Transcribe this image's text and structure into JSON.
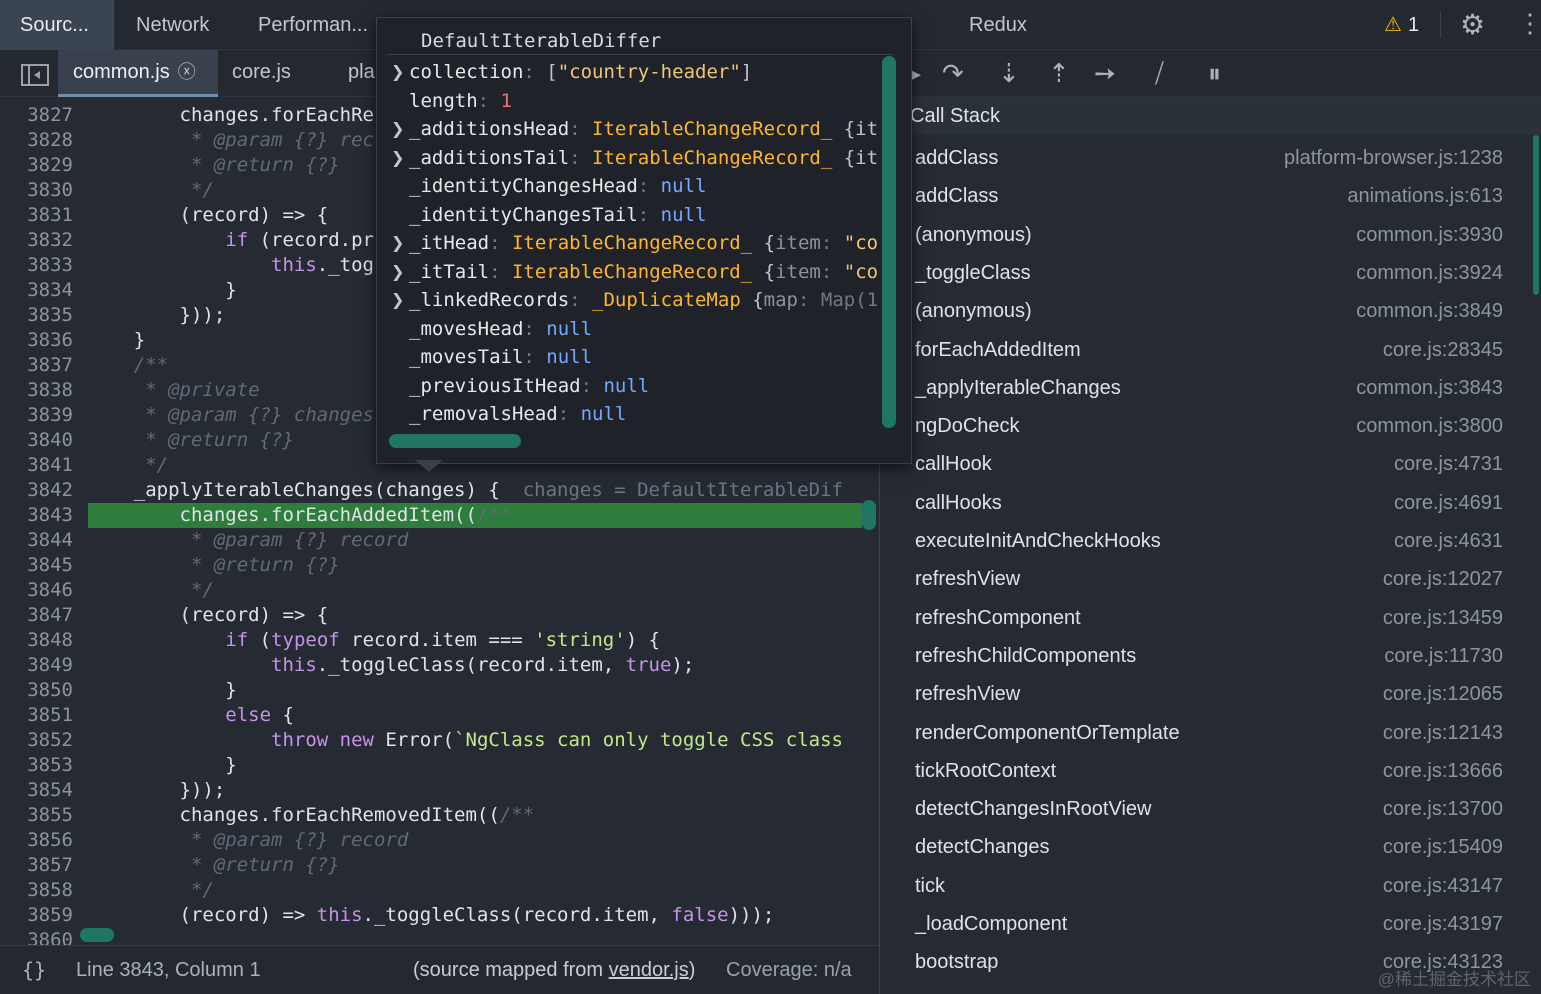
{
  "panel_tabs": {
    "sources": "Sourc...",
    "network": "Network",
    "performance": "Performan...",
    "redux": "Redux",
    "warning_count": "1"
  },
  "file_tabs": [
    "common.js",
    "core.js",
    "pla"
  ],
  "code_lines": [
    {
      "n": "3827",
      "html": "        changes.forEachRe"
    },
    {
      "n": "3828",
      "html": "         <span class=\"cm\">* @param {?} rec</span>"
    },
    {
      "n": "3829",
      "html": "         <span class=\"cm\">* @return {?}</span>"
    },
    {
      "n": "3830",
      "html": "         <span class=\"cm\">*/</span>"
    },
    {
      "n": "3831",
      "html": "        (record) =&gt; {"
    },
    {
      "n": "3832",
      "html": "            <span class=\"kw\">if</span> (record.pr"
    },
    {
      "n": "3833",
      "html": "                <span class=\"kw\">this</span>._tog"
    },
    {
      "n": "3834",
      "html": "            }"
    },
    {
      "n": "3835",
      "html": "        }));"
    },
    {
      "n": "3836",
      "html": "    }"
    },
    {
      "n": "3837",
      "html": "    <span class=\"cm\">/**</span>"
    },
    {
      "n": "3838",
      "html": "     <span class=\"cm\">* @private</span>"
    },
    {
      "n": "3839",
      "html": "     <span class=\"cm\">* @param {?} changes</span>"
    },
    {
      "n": "3840",
      "html": "     <span class=\"cm\">* @return {?}</span>"
    },
    {
      "n": "3841",
      "html": "     <span class=\"cm\">*/</span>"
    },
    {
      "n": "3842",
      "html": "    _applyIterableChanges(changes) {  <span class=\"inl\">changes = DefaultIterableDif</span>"
    },
    {
      "n": "3843",
      "html": "        changes.forEachAddedItem((<span class=\"cm\">/**</span>"
    },
    {
      "n": "3844",
      "html": "         <span class=\"cm\">* @param {?} record</span>"
    },
    {
      "n": "3845",
      "html": "         <span class=\"cm\">* @return {?}</span>"
    },
    {
      "n": "3846",
      "html": "         <span class=\"cm\">*/</span>"
    },
    {
      "n": "3847",
      "html": "        (record) =&gt; {"
    },
    {
      "n": "3848",
      "html": "            <span class=\"kw\">if</span> (<span class=\"kw\">typeof</span> record.item === <span class=\"str\">'string'</span>) {"
    },
    {
      "n": "3849",
      "html": "                <span class=\"kw\">this</span>._toggleClass(record.item, <span class=\"kw\">true</span>);"
    },
    {
      "n": "3850",
      "html": "            }"
    },
    {
      "n": "3851",
      "html": "            <span class=\"kw\">else</span> {"
    },
    {
      "n": "3852",
      "html": "                <span class=\"kw\">throw new</span> Error(<span class=\"str\">`NgClass can only toggle CSS class</span>"
    },
    {
      "n": "3853",
      "html": "            }"
    },
    {
      "n": "3854",
      "html": "        }));"
    },
    {
      "n": "3855",
      "html": "        changes.forEachRemovedItem((<span class=\"cm\">/**</span>"
    },
    {
      "n": "3856",
      "html": "         <span class=\"cm\">* @param {?} record</span>"
    },
    {
      "n": "3857",
      "html": "         <span class=\"cm\">* @return {?}</span>"
    },
    {
      "n": "3858",
      "html": "         <span class=\"cm\">*/</span>"
    },
    {
      "n": "3859",
      "html": "        (record) =&gt; <span class=\"kw\">this</span>._toggleClass(record.item, <span class=\"kw\">false</span>)));"
    },
    {
      "n": "3860",
      "html": ""
    }
  ],
  "highlighted_line": "3843",
  "status": {
    "braces": "{}",
    "position": "Line 3843, Column 1",
    "source_map_prefix": "(source mapped from ",
    "source_map_file": "vendor.js",
    "source_map_suffix": ")",
    "coverage": "Coverage: n/a"
  },
  "call_stack": {
    "title": "Call Stack",
    "frames": [
      {
        "fn": "addClass",
        "loc": "platform-browser.js:1238"
      },
      {
        "fn": "addClass",
        "loc": "animations.js:613"
      },
      {
        "fn": "(anonymous)",
        "loc": "common.js:3930"
      },
      {
        "fn": "_toggleClass",
        "loc": "common.js:3924"
      },
      {
        "fn": "(anonymous)",
        "loc": "common.js:3849"
      },
      {
        "fn": "forEachAddedItem",
        "loc": "core.js:28345"
      },
      {
        "fn": "_applyIterableChanges",
        "loc": "common.js:3843"
      },
      {
        "fn": "ngDoCheck",
        "loc": "common.js:3800"
      },
      {
        "fn": "callHook",
        "loc": "core.js:4731"
      },
      {
        "fn": "callHooks",
        "loc": "core.js:4691"
      },
      {
        "fn": "executeInitAndCheckHooks",
        "loc": "core.js:4631"
      },
      {
        "fn": "refreshView",
        "loc": "core.js:12027"
      },
      {
        "fn": "refreshComponent",
        "loc": "core.js:13459"
      },
      {
        "fn": "refreshChildComponents",
        "loc": "core.js:11730"
      },
      {
        "fn": "refreshView",
        "loc": "core.js:12065"
      },
      {
        "fn": "renderComponentOrTemplate",
        "loc": "core.js:12143"
      },
      {
        "fn": "tickRootContext",
        "loc": "core.js:13666"
      },
      {
        "fn": "detectChangesInRootView",
        "loc": "core.js:13700"
      },
      {
        "fn": "detectChanges",
        "loc": "core.js:15409"
      },
      {
        "fn": "tick",
        "loc": "core.js:43147"
      },
      {
        "fn": "_loadComponent",
        "loc": "core.js:43197"
      },
      {
        "fn": "bootstrap",
        "loc": "core.js:43123"
      }
    ]
  },
  "popover": {
    "title": "DefaultIterableDiffer",
    "rows": [
      {
        "expand": true,
        "html": "<span class=\"pk\">collection</span><span class=\"pc\">: </span><span class=\"pq\">[</span><span class=\"pstr\">\"country-header\"</span><span class=\"pq\">]</span>"
      },
      {
        "expand": false,
        "html": "<span class=\"pk\">length</span><span class=\"pc\">: </span><span class=\"pnum\">1</span>"
      },
      {
        "expand": true,
        "html": "<span class=\"pk\">_additionsHead</span><span class=\"pc\">: </span><span class=\"pcls\">IterableChangeRecord_</span> <span class=\"pq\">{it</span>"
      },
      {
        "expand": true,
        "html": "<span class=\"pk\">_additionsTail</span><span class=\"pc\">: </span><span class=\"pcls\">IterableChangeRecord_</span> <span class=\"pq\">{it</span>"
      },
      {
        "expand": false,
        "html": "<span class=\"pk\">_identityChangesHead</span><span class=\"pc\">: </span><span class=\"pnull\">null</span>"
      },
      {
        "expand": false,
        "html": "<span class=\"pk\">_identityChangesTail</span><span class=\"pc\">: </span><span class=\"pnull\">null</span>"
      },
      {
        "expand": true,
        "html": "<span class=\"pk\">_itHead</span><span class=\"pc\">: </span><span class=\"pcls\">IterableChangeRecord_</span> <span class=\"pq\">{</span><span class=\"pdim\">item</span><span class=\"pc\">: </span><span class=\"pstr\">\"co</span>"
      },
      {
        "expand": true,
        "html": "<span class=\"pk\">_itTail</span><span class=\"pc\">: </span><span class=\"pcls\">IterableChangeRecord_</span> <span class=\"pq\">{</span><span class=\"pdim\">item</span><span class=\"pc\">: </span><span class=\"pstr\">\"co</span>"
      },
      {
        "expand": true,
        "html": "<span class=\"pk\">_linkedRecords</span><span class=\"pc\">: </span><span class=\"pcls\">_DuplicateMap</span> <span class=\"pq\">{</span><span class=\"pdim\">map</span><span class=\"pc\">: Map(1</span>"
      },
      {
        "expand": false,
        "html": "<span class=\"pk\">_movesHead</span><span class=\"pc\">: </span><span class=\"pnull\">null</span>"
      },
      {
        "expand": false,
        "html": "<span class=\"pk\">_movesTail</span><span class=\"pc\">: </span><span class=\"pnull\">null</span>"
      },
      {
        "expand": false,
        "html": "<span class=\"pk\">_previousItHead</span><span class=\"pc\">: </span><span class=\"pnull\">null</span>"
      },
      {
        "expand": false,
        "html": "<span class=\"pk\">_removalsHead</span><span class=\"pc\">: </span><span class=\"pnull\">null</span>"
      }
    ]
  },
  "watermark": "@稀土掘金技术社区",
  "colors": {
    "accent": "#1f7763",
    "highlight_line": "#2f7d3c",
    "warning": "#f2b705"
  }
}
